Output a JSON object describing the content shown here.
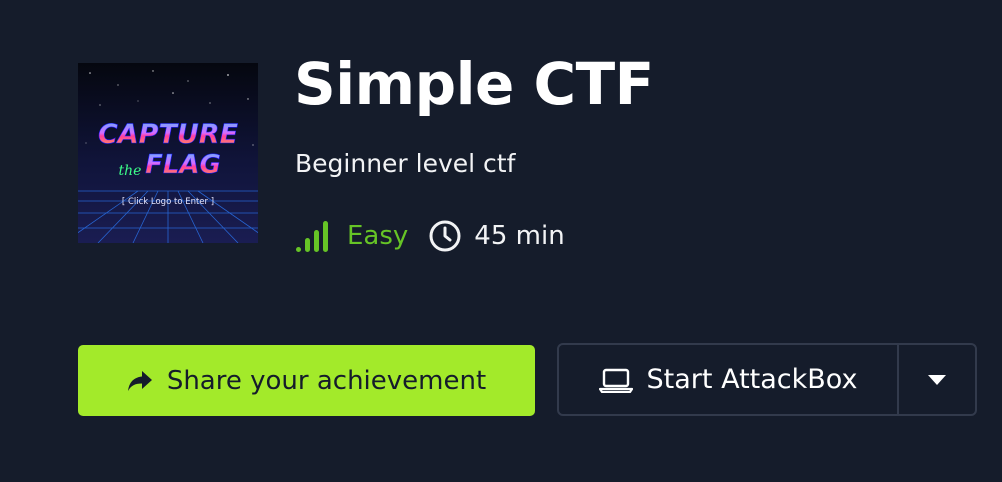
{
  "room": {
    "title": "Simple CTF",
    "description": "Beginner level ctf",
    "difficulty": "Easy",
    "duration": "45 min",
    "logo": {
      "line1": "CAPTURE",
      "line2_small": "the",
      "line2": "FLAG",
      "caption": "[ Click Logo to Enter ]"
    }
  },
  "actions": {
    "share_label": "Share your achievement",
    "attackbox_label": "Start AttackBox"
  },
  "icons": {
    "share": "share-arrow-icon",
    "difficulty": "signal-bars-icon",
    "duration": "clock-icon",
    "attackbox": "laptop-icon",
    "dropdown": "caret-down-icon"
  },
  "colors": {
    "background": "#151c2b",
    "accent_green": "#a3ea2a",
    "difficulty_green": "#66c426",
    "border": "#323a4c"
  }
}
